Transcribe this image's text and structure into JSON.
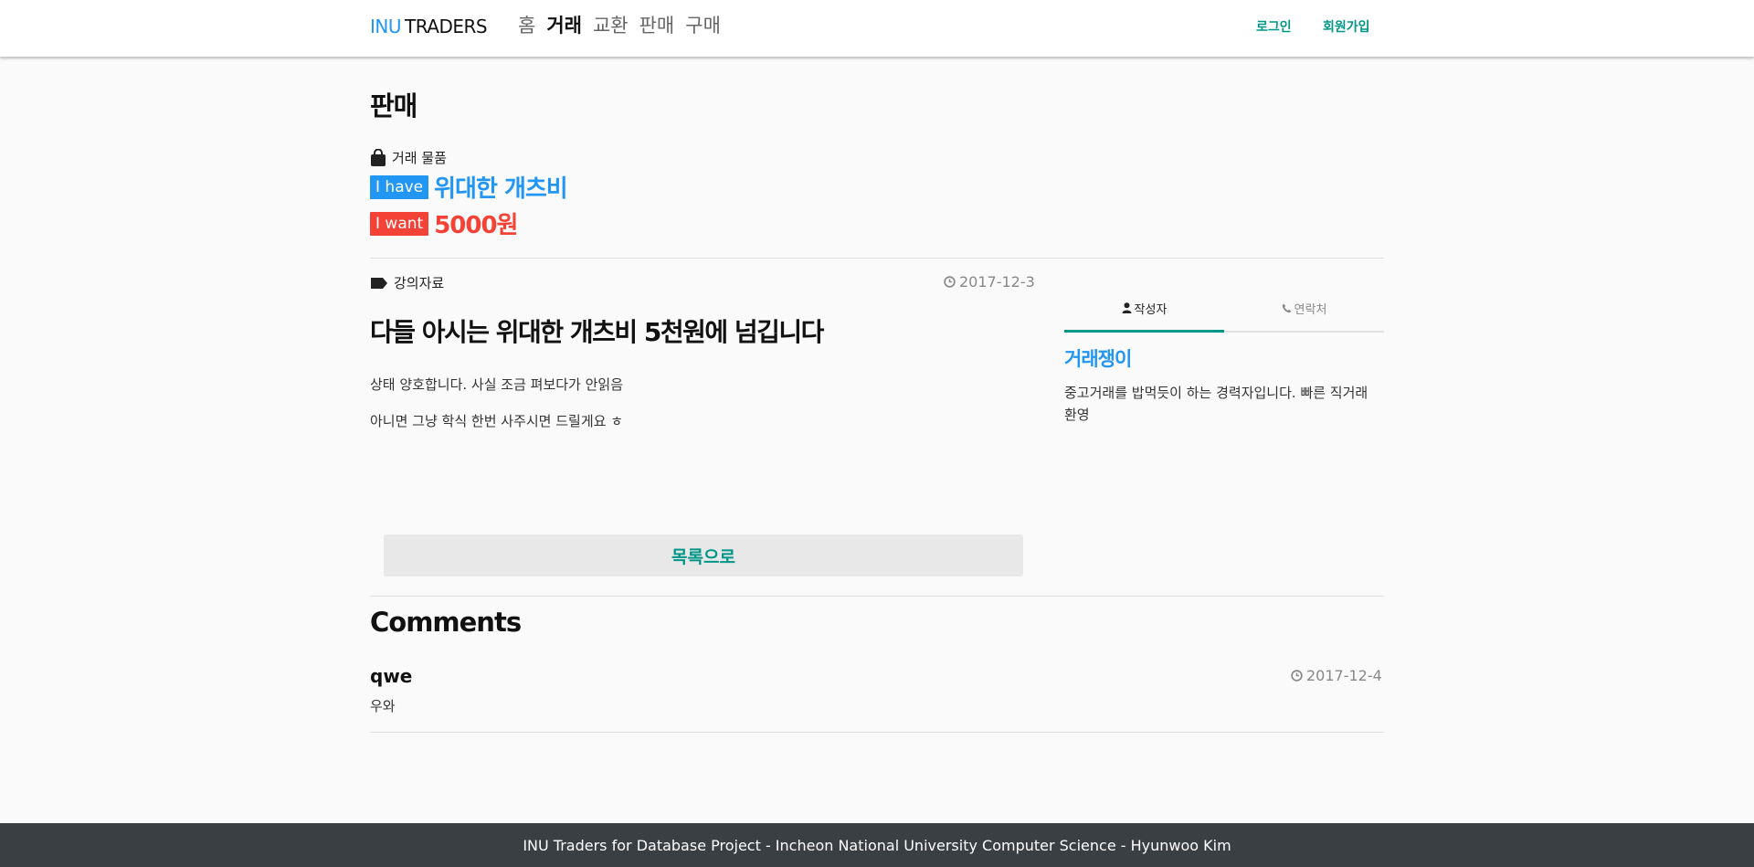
{
  "header": {
    "brand_accent": "INU",
    "brand_rest": "TRADERS",
    "nav": [
      {
        "label": "홈"
      },
      {
        "label": "거래"
      },
      {
        "label": "교환"
      },
      {
        "label": "판매"
      },
      {
        "label": "구매"
      }
    ],
    "login": "로그인",
    "signup": "회원가입"
  },
  "page": {
    "title": "판매"
  },
  "item": {
    "heading": "거래 물품",
    "have_badge": "I have",
    "have_value": "위대한 개츠비",
    "want_badge": "I want",
    "want_value": "5000원"
  },
  "post": {
    "category": "강의자료",
    "date": "2017-12-3",
    "title": "다들 아시는 위대한 개츠비 5천원에 넘깁니다",
    "body": [
      "상태 양호합니다. 사실 조금 펴보다가 안읽음",
      "아니면 그냥 학식 한번 사주시면 드릴게요 ㅎ"
    ],
    "back_button": "목록으로"
  },
  "side": {
    "tabs": [
      {
        "label": "작성자",
        "icon": "user-icon"
      },
      {
        "label": "연락처",
        "icon": "phone-icon"
      }
    ],
    "seller_name": "거래쟁이",
    "seller_desc": "중고거래를 밥먹듯이 하는 경력자입니다. 빠른 직거래 환영"
  },
  "comments": {
    "title": "Comments",
    "items": [
      {
        "author": "qwe",
        "date": "2017-12-4",
        "text": "우와"
      }
    ]
  },
  "footer": {
    "text": "INU Traders for Database Project - Incheon National University Computer Science - Hyunwoo Kim"
  },
  "colors": {
    "brand_blue": "#2196f3",
    "accent_teal": "#009688",
    "want_red": "#f44336",
    "footer_bg": "#3a3f44"
  }
}
